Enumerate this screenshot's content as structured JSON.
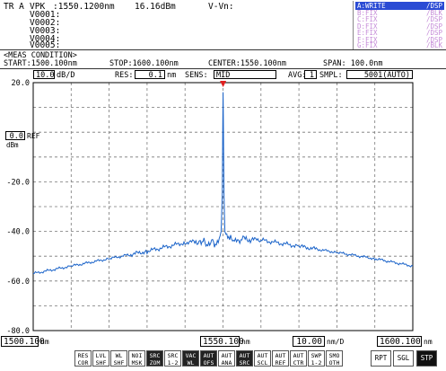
{
  "header": {
    "trace_label": "TR A",
    "marker_label": "VPK",
    "marker_wavelength": ":1550.1200nm",
    "marker_level": "16.16dBm",
    "delta_label": "V-Vn:",
    "markers": [
      "V0001:",
      "V0002:",
      "V0003:",
      "V0004:",
      "V0005:"
    ]
  },
  "traces": [
    {
      "name": "A:WRITE",
      "mode": "/DSP",
      "active": true
    },
    {
      "name": "B:FIX",
      "mode": "/BLK",
      "active": false
    },
    {
      "name": "C:FIX",
      "mode": "/DSP",
      "active": false
    },
    {
      "name": "D:FIX",
      "mode": "/DSP",
      "active": false
    },
    {
      "name": "E:FIX",
      "mode": "/DSP",
      "active": false
    },
    {
      "name": "F:FIX",
      "mode": "/DSP",
      "active": false
    },
    {
      "name": "G:FIX",
      "mode": "/BLK",
      "active": false
    }
  ],
  "conditions": {
    "title": "<MEAS CONDITION>",
    "start": "START:1500.100nm",
    "stop": "STOP:1600.100nm",
    "center": "CENTER:1550.100nm",
    "span": "SPAN: 100.0nm"
  },
  "settings": {
    "scale_value": "10.0",
    "scale_unit": "dB/D",
    "res_label": "RES:",
    "res_value": "0.1",
    "res_unit": "nm",
    "sens_label": "SENS:",
    "sens_value": "MID",
    "avg_label": "AVG:",
    "avg_value": "1",
    "smpl_label": "SMPL:",
    "smpl_value": "5001(AUTO)"
  },
  "ref": {
    "value": "0.0",
    "label": "REF",
    "unit": "dBm"
  },
  "bottom_axis": {
    "start_value": "1500.100",
    "center_value": "1550.100",
    "div_value": "10.00",
    "stop_value": "1600.100",
    "unit": "nm",
    "div_unit": "nm/D"
  },
  "softkeys": [
    {
      "l1": "RES",
      "l2": "COR",
      "dark": false
    },
    {
      "l1": "LVL",
      "l2": "SHF",
      "dark": false
    },
    {
      "l1": "WL",
      "l2": "SHF",
      "dark": false
    },
    {
      "l1": "NOI",
      "l2": "MSK",
      "dark": false
    },
    {
      "l1": "SRC",
      "l2": "ZOM",
      "dark": true
    },
    {
      "l1": "SRC",
      "l2": "1-2",
      "dark": false
    },
    {
      "l1": "VAC",
      "l2": "WL",
      "dark": true
    },
    {
      "l1": "AUT",
      "l2": "OFS",
      "dark": true
    },
    {
      "l1": "AUT",
      "l2": "ANA",
      "dark": false
    },
    {
      "l1": "AUT",
      "l2": "SRC",
      "dark": true
    },
    {
      "l1": "AUT",
      "l2": "SCL",
      "dark": false
    },
    {
      "l1": "AUT",
      "l2": "REF",
      "dark": false
    },
    {
      "l1": "AUT",
      "l2": "CTR",
      "dark": false
    },
    {
      "l1": "SWP",
      "l2": "1-2",
      "dark": false
    },
    {
      "l1": "SMO",
      "l2": "OTH",
      "dark": false
    }
  ],
  "sweep_buttons": [
    {
      "label": "RPT",
      "dark": false
    },
    {
      "label": "SGL",
      "dark": false
    },
    {
      "label": "STP",
      "dark": true
    }
  ],
  "chart_data": {
    "type": "line",
    "xlim": [
      1500.1,
      1600.1
    ],
    "ylim": [
      -80,
      20
    ],
    "y_ticks": [
      "20.0",
      "0.0",
      "-20.0",
      "-40.0",
      "-60.0",
      "-80.0"
    ],
    "grid": true,
    "peak_marker": {
      "x": 1550.12,
      "y": 16.16
    },
    "trace_color": "#1a63c9",
    "series": [
      {
        "x": [
          1500.1,
          1510.1,
          1520.1,
          1530.1,
          1540.1,
          1544.1,
          1545.1,
          1546.1,
          1547.1,
          1548.1,
          1549.1,
          1549.6,
          1549.9,
          1550.05,
          1550.12,
          1550.2,
          1550.35,
          1550.6,
          1551.1,
          1552.1,
          1553.1,
          1555.1,
          1560.1,
          1570.1,
          1580.1,
          1590.1,
          1600.1
        ],
        "y": [
          -57,
          -54,
          -51,
          -48,
          -44.5,
          -44,
          -43.5,
          -46,
          -43.5,
          -46,
          -44,
          -40,
          -25,
          5,
          16.16,
          5,
          -25,
          -40,
          -42,
          -43,
          -44.5,
          -43,
          -43.5,
          -46,
          -48.5,
          -51,
          -54
        ]
      }
    ]
  }
}
